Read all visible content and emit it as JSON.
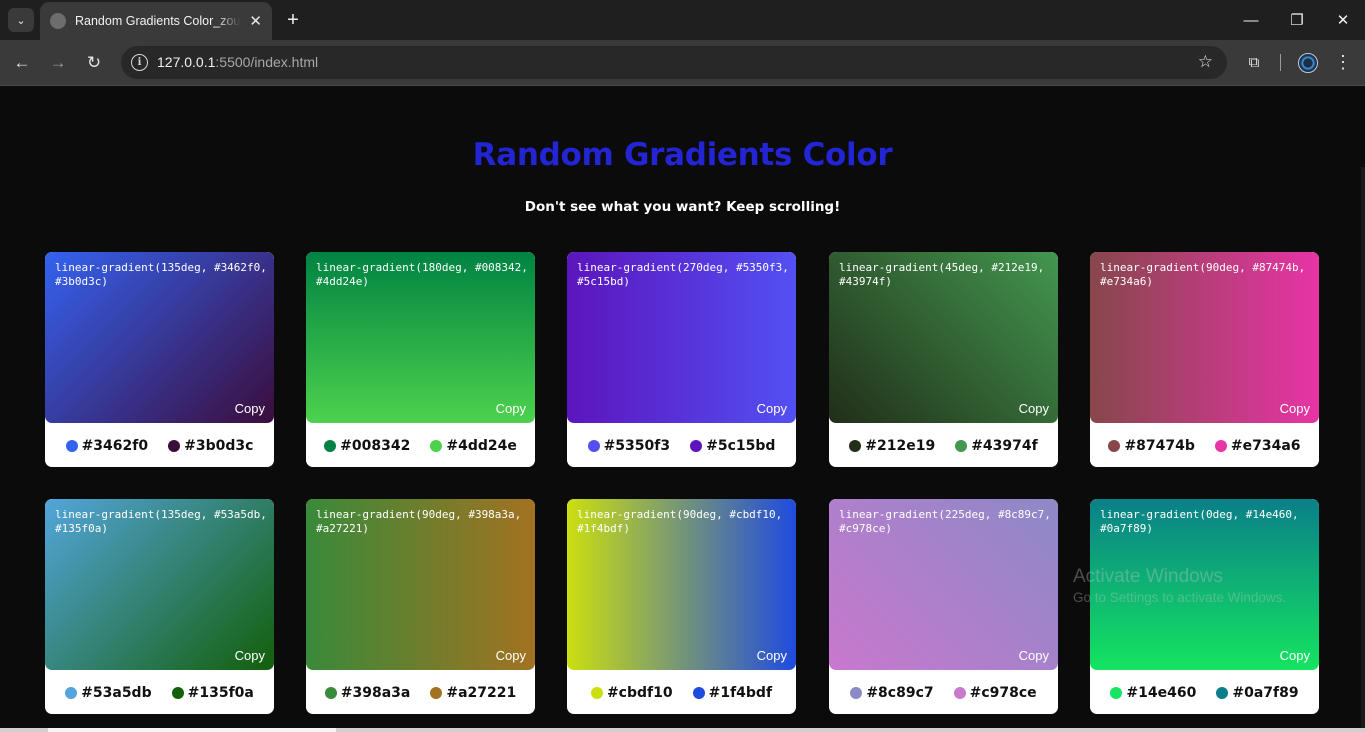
{
  "browser": {
    "tab_title": "Random Gradients Color_zouraiz",
    "url_host": "127.0.0.1",
    "url_rest": ":5500/index.html"
  },
  "page": {
    "title": "Random Gradients Color",
    "subtitle": "Don't see what you want? Keep scrolling!",
    "copy_label": "Copy",
    "title_color": "#2324d4"
  },
  "cards": [
    {
      "code": "linear-gradient(135deg, #3462f0, #3b0d3c)",
      "angle": 135,
      "color1": "#3462f0",
      "color2": "#3b0d3c"
    },
    {
      "code": "linear-gradient(180deg, #008342, #4dd24e)",
      "angle": 180,
      "color1": "#008342",
      "color2": "#4dd24e"
    },
    {
      "code": "linear-gradient(270deg, #5350f3, #5c15bd)",
      "angle": 270,
      "color1": "#5350f3",
      "color2": "#5c15bd"
    },
    {
      "code": "linear-gradient(45deg, #212e19, #43974f)",
      "angle": 45,
      "color1": "#212e19",
      "color2": "#43974f"
    },
    {
      "code": "linear-gradient(90deg, #87474b, #e734a6)",
      "angle": 90,
      "color1": "#87474b",
      "color2": "#e734a6"
    },
    {
      "code": "linear-gradient(135deg, #53a5db, #135f0a)",
      "angle": 135,
      "color1": "#53a5db",
      "color2": "#135f0a"
    },
    {
      "code": "linear-gradient(90deg, #398a3a, #a27221)",
      "angle": 90,
      "color1": "#398a3a",
      "color2": "#a27221"
    },
    {
      "code": "linear-gradient(90deg, #cbdf10, #1f4bdf)",
      "angle": 90,
      "color1": "#cbdf10",
      "color2": "#1f4bdf"
    },
    {
      "code": "linear-gradient(225deg, #8c89c7, #c978ce)",
      "angle": 225,
      "color1": "#8c89c7",
      "color2": "#c978ce"
    },
    {
      "code": "linear-gradient(0deg, #14e460, #0a7f89)",
      "angle": 0,
      "color1": "#14e460",
      "color2": "#0a7f89"
    }
  ],
  "watermark": {
    "line1": "Activate Windows",
    "line2": "Go to Settings to activate Windows."
  }
}
